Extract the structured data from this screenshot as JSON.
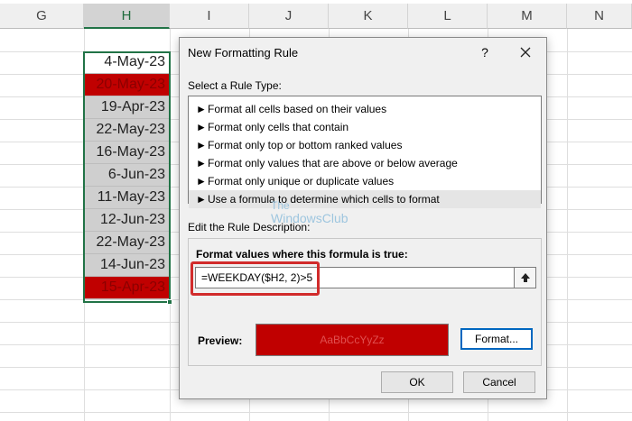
{
  "spreadsheet": {
    "columns": [
      "G",
      "H",
      "I",
      "J",
      "K",
      "L",
      "M",
      "N"
    ],
    "selected_column": "H",
    "cells": [
      {
        "value": "4-May-23",
        "fill": "white"
      },
      {
        "value": "20-May-23",
        "fill": "red"
      },
      {
        "value": "19-Apr-23",
        "fill": "grey"
      },
      {
        "value": "22-May-23",
        "fill": "grey"
      },
      {
        "value": "16-May-23",
        "fill": "grey"
      },
      {
        "value": "6-Jun-23",
        "fill": "grey"
      },
      {
        "value": "11-May-23",
        "fill": "grey"
      },
      {
        "value": "12-Jun-23",
        "fill": "grey"
      },
      {
        "value": "22-May-23",
        "fill": "grey"
      },
      {
        "value": "14-Jun-23",
        "fill": "grey"
      },
      {
        "value": "15-Apr-23",
        "fill": "red"
      }
    ]
  },
  "dialog": {
    "title": "New Formatting Rule",
    "help_label": "?",
    "close_icon": "close-icon",
    "select_rule_label": "Select a Rule Type:",
    "rule_types": [
      "Format all cells based on their values",
      "Format only cells that contain",
      "Format only top or bottom ranked values",
      "Format only values that are above or below average",
      "Format only unique or duplicate values",
      "Use a formula to determine which cells to format"
    ],
    "selected_rule_index": 5,
    "edit_rule_label": "Edit the Rule Description:",
    "formula_label": "Format values where this formula is true:",
    "formula_value": "=WEEKDAY($H2, 2)>5",
    "preview_label": "Preview:",
    "preview_text": "AaBbCcYyZz",
    "preview_fill": "#c00000",
    "format_button": "Format...",
    "ok_button": "OK",
    "cancel_button": "Cancel"
  },
  "watermark": {
    "line1": "The",
    "line2": "WindowsClub"
  },
  "colors": {
    "selection_green": "#217346",
    "highlight_red": "#d12b2b",
    "accent_blue": "#0067c0"
  }
}
